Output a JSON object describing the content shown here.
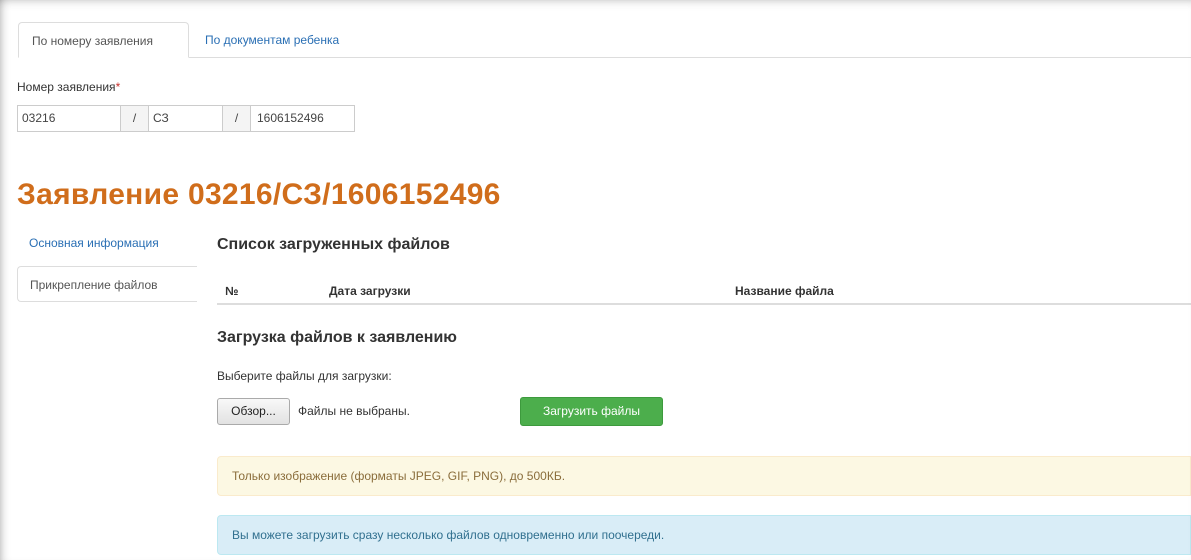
{
  "tabs": [
    {
      "label": "По номеру заявления",
      "active": true
    },
    {
      "label": "По документам ребенка",
      "active": false
    }
  ],
  "application_number": {
    "label": "Номер заявления",
    "required_mark": "*",
    "part1": "03216",
    "separator": "/",
    "part2": "СЗ",
    "part3": "1606152496"
  },
  "page_title": "Заявление 03216/СЗ/1606152496",
  "sidenav": {
    "items": [
      {
        "label": "Основная информация",
        "active": false
      },
      {
        "label": "Прикрепление файлов",
        "active": true
      }
    ]
  },
  "files_list": {
    "heading": "Список загруженных файлов",
    "columns": [
      "№",
      "Дата загрузки",
      "Название файла"
    ]
  },
  "upload": {
    "heading": "Загрузка файлов к заявлению",
    "choose_label": "Выберите файлы для загрузки:",
    "browse_label": "Обзор...",
    "no_files_text": "Файлы не выбраны.",
    "upload_button": "Загрузить файлы"
  },
  "alerts": {
    "warning": "Только изображение (форматы JPEG, GIF, PNG), до 500КБ.",
    "info": "Вы можете загрузить сразу несколько файлов одновременно или поочереди."
  },
  "colors": {
    "title": "#d06d1b",
    "link": "#2a6fb4",
    "upload_button": "#4cae4c",
    "warning_bg": "#fcf8e3",
    "info_bg": "#d9edf7"
  }
}
